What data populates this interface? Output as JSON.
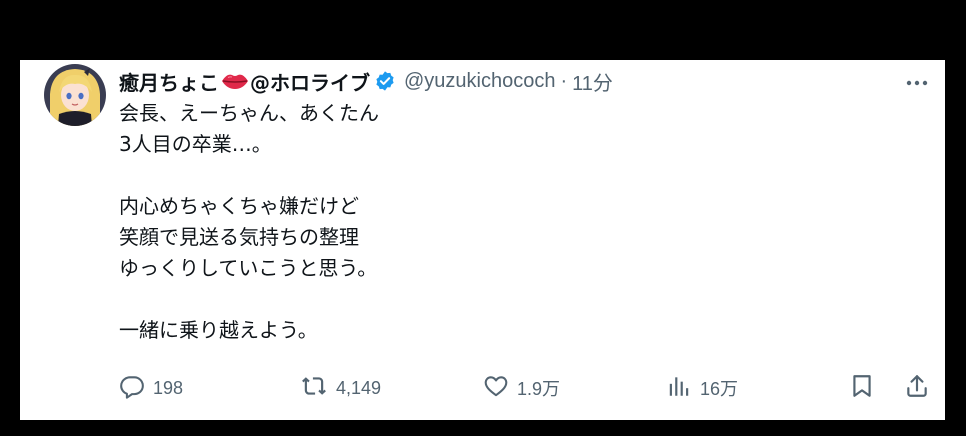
{
  "tweet": {
    "display_name": "癒月ちょこ",
    "display_name_suffix": "@ホロライブ",
    "handle": "@yuzukichococh",
    "separator": "·",
    "time": "11分",
    "body_lines": [
      "会長、えーちゃん、あくたん",
      "3人目の卒業…。",
      "",
      "内心めちゃくちゃ嫌だけど",
      "笑顔で見送る気持ちの整理",
      "ゆっくりしていこうと思う。",
      "",
      "一緒に乗り越えよう。"
    ]
  },
  "actions": {
    "replies": "198",
    "retweets": "4,149",
    "likes": "1.9万",
    "views": "16万"
  },
  "icons": {
    "lips": "lips-icon",
    "verified": "verified-badge-icon",
    "more": "more-dots-icon",
    "reply": "reply-icon",
    "retweet": "retweet-icon",
    "like": "heart-icon",
    "views": "views-chart-icon",
    "bookmark": "bookmark-icon",
    "share": "share-icon"
  },
  "colors": {
    "background": "#000000",
    "card": "#ffffff",
    "text": "#0f1419",
    "secondary": "#536471",
    "verified": "#1d9bf0"
  }
}
